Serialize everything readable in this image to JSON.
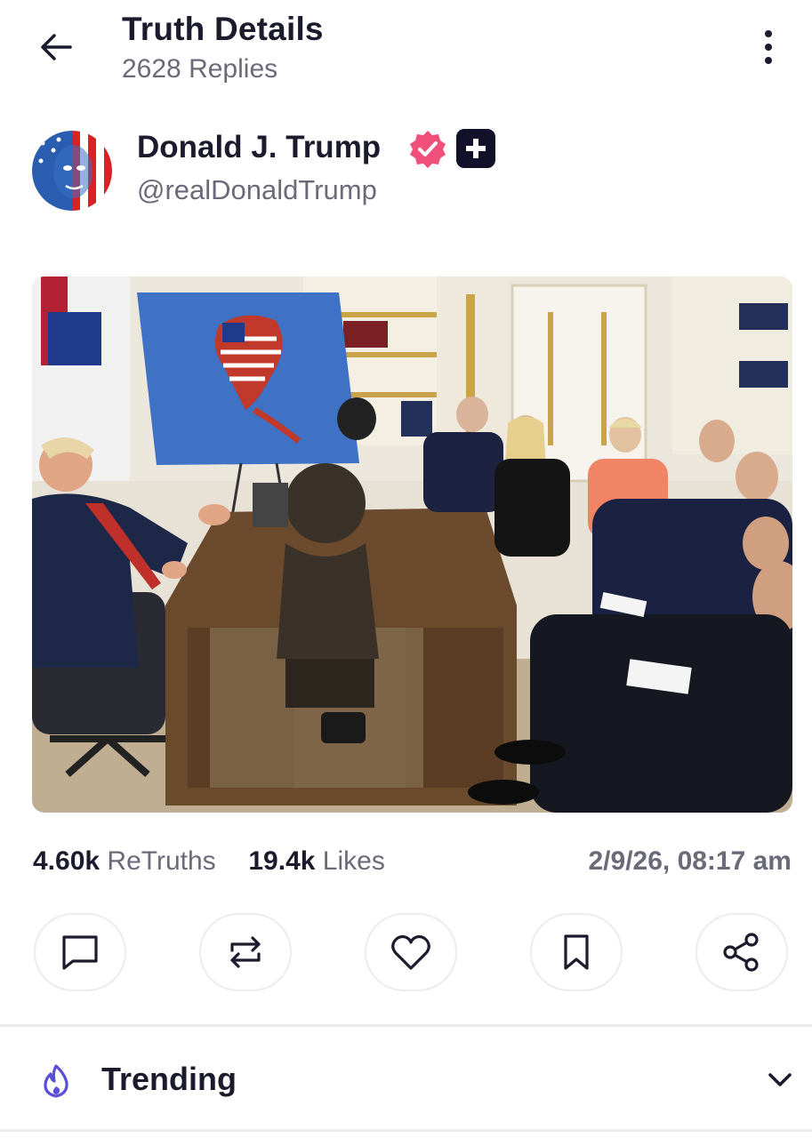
{
  "header": {
    "title": "Truth Details",
    "replies": "2628 Replies",
    "back_icon": "arrow-left-icon",
    "menu_icon": "more-vertical-icon"
  },
  "author": {
    "name": "Donald J. Trump",
    "handle": "@realDonaldTrump",
    "verified_icon": "verified-badge-icon",
    "plus_icon": "plus-badge-icon"
  },
  "post": {
    "image_description_icon": "post-photo"
  },
  "stats": {
    "retruths_count": "4.60k",
    "retruths_label": "ReTruths",
    "likes_count": "19.4k",
    "likes_label": "Likes",
    "timestamp": "2/9/26, 08:17 am"
  },
  "actions": [
    {
      "icon": "reply-icon"
    },
    {
      "icon": "retruth-icon"
    },
    {
      "icon": "like-icon"
    },
    {
      "icon": "bookmark-icon"
    },
    {
      "icon": "share-icon"
    }
  ],
  "trending": {
    "label": "Trending",
    "icon": "flame-icon",
    "expand_icon": "chevron-down-icon"
  },
  "colors": {
    "accent": "#5b4fd6",
    "verified": "#f0507a",
    "text": "#1c1b2e",
    "muted": "#6b6a78"
  }
}
